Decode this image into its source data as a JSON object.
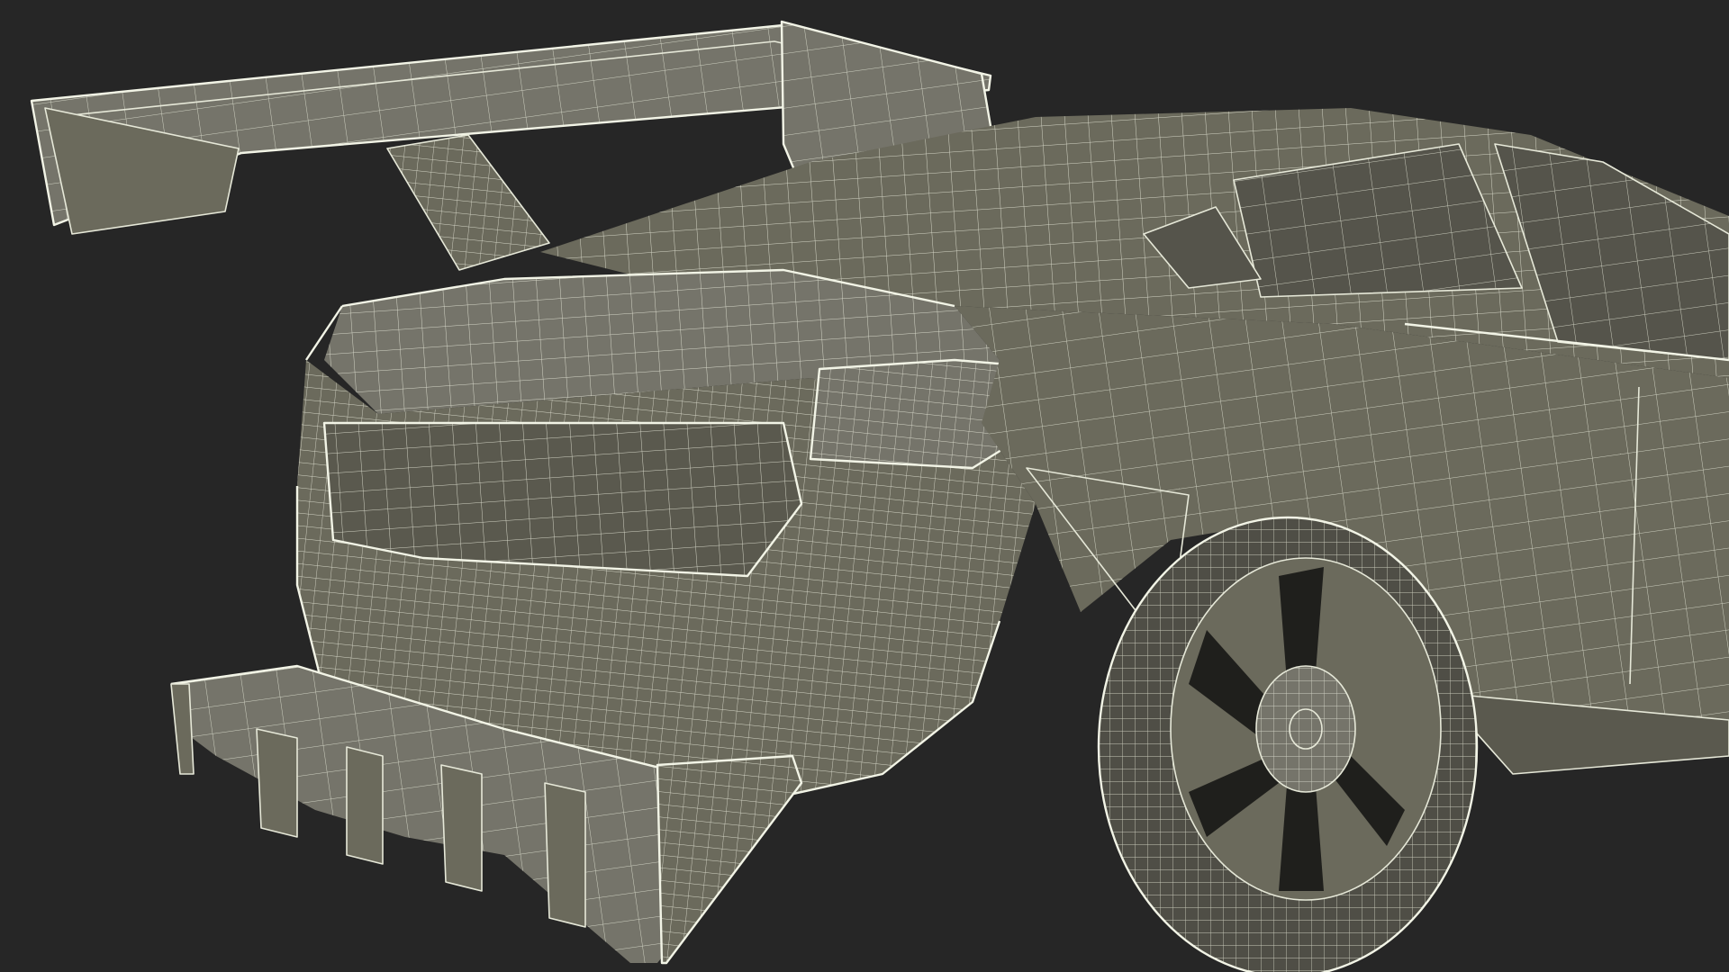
{
  "viewport": {
    "background": "#262626"
  },
  "model": {
    "subject": "car-wireframe-render",
    "colors": {
      "body": "#6b6a5c",
      "wire": "#e6e8d8",
      "shadow": "#1f1f1c"
    }
  }
}
